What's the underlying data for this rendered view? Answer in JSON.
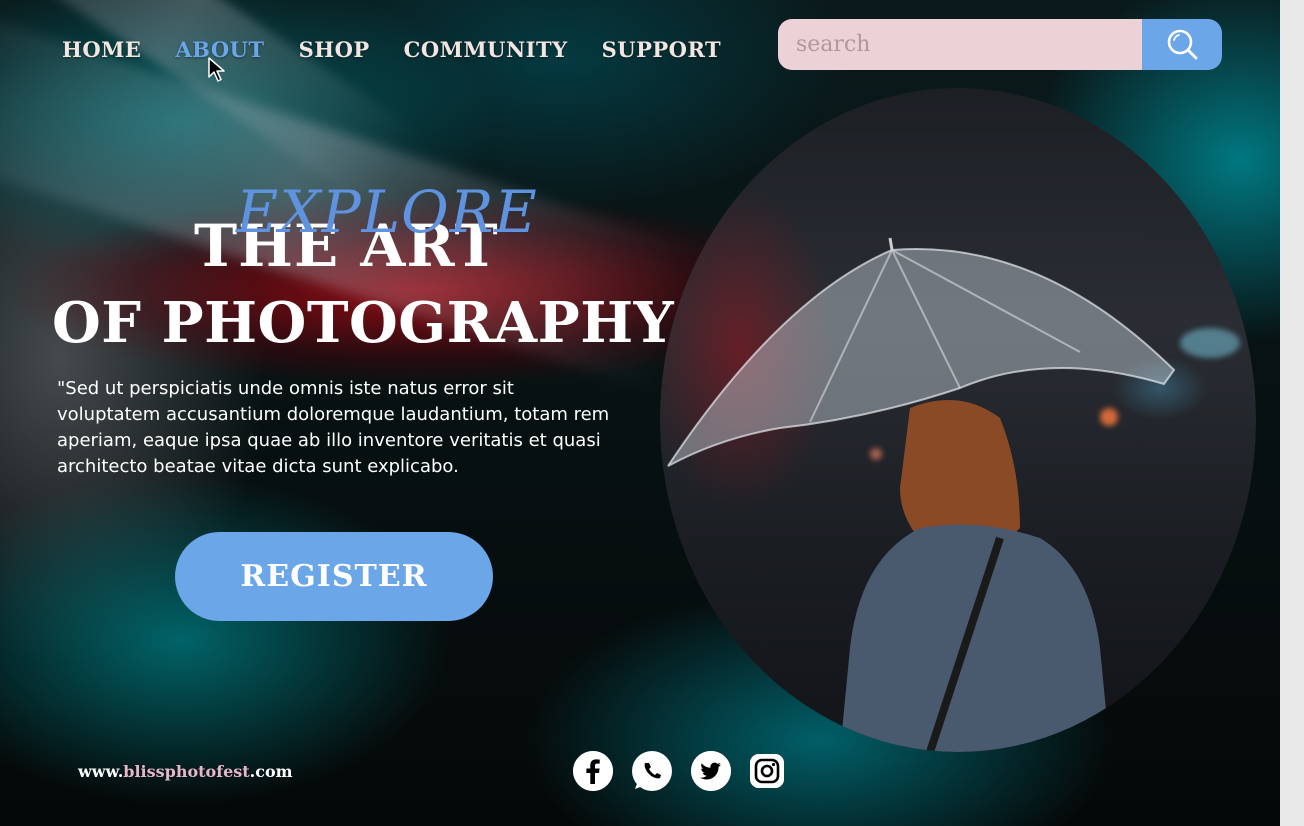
{
  "nav": {
    "items": [
      {
        "label": "HOME",
        "active": false
      },
      {
        "label": "ABOUT",
        "active": true
      },
      {
        "label": "SHOP",
        "active": false
      },
      {
        "label": "COMMUNITY",
        "active": false
      },
      {
        "label": "SUPPORT",
        "active": false
      }
    ]
  },
  "search": {
    "placeholder": "search",
    "button_icon": "search-icon"
  },
  "hero": {
    "kicker": "EXPLORE",
    "title_line1": "THE ART",
    "title_line2": "OF PHOTOGRAPHY",
    "paragraph": "\"Sed ut perspiciatis unde omnis iste natus error sit voluptatem accusantium doloremque laudantium, totam rem aperiam, eaque ipsa quae ab illo inventore veritatis et quasi architecto beatae vitae dicta sunt explicabo.",
    "cta_label": "REGISTER"
  },
  "footer": {
    "url_prefix": "www.",
    "url_domain": "blissphotofest",
    "url_suffix": ".com",
    "social": [
      "facebook-icon",
      "whatsapp-icon",
      "twitter-icon",
      "instagram-icon"
    ]
  },
  "colors": {
    "accent": "#6aa6e8",
    "kicker": "#5f92df",
    "search_bg": "#ecd2d6",
    "url_domain": "#e8b6c6"
  }
}
